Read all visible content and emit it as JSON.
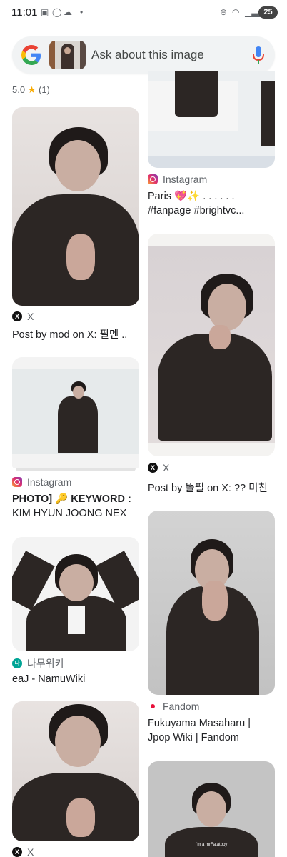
{
  "status_bar": {
    "time": "11:01",
    "left_icons": [
      "screenshot-icon",
      "whatsapp-icon",
      "cloud-icon",
      "dot-icon"
    ],
    "right_icons": [
      "dnd-icon",
      "wifi-icon",
      "signal-icon"
    ],
    "battery": "25"
  },
  "search": {
    "placeholder": "Ask about this image",
    "logo": "google-g-logo",
    "mic": "mic-icon"
  },
  "rating": {
    "value": "5.0",
    "star": "★",
    "count": "(1)"
  },
  "results": {
    "left": [
      {
        "source": "X",
        "source_icon": "x-icon",
        "title": "Post by mod on X: 필멘 .."
      },
      {
        "source": "Instagram",
        "source_icon": "instagram-icon",
        "title_line1": "PHOTO] 🔑 KEYWORD :",
        "title_line2": "KIM HYUN JOONG NEX"
      },
      {
        "source": "나무위키",
        "source_icon": "namuwiki-icon",
        "title": "eaJ - NamuWiki"
      },
      {
        "source": "X",
        "source_icon": "x-icon"
      }
    ],
    "right": [
      {
        "source": "Instagram",
        "source_icon": "instagram-icon",
        "title_line1": "Paris 💖✨ . . . . . .",
        "title_line2": "#fanpage #brightvc..."
      },
      {
        "source": "X",
        "source_icon": "x-icon",
        "title": "Post by 똘필 on X: ?? 미친"
      },
      {
        "source": "Fandom",
        "source_icon": "fandom-icon",
        "title_line1": "Fukuyama Masaharu |",
        "title_line2": "Jpop Wiki | Fandom"
      },
      {
        "caption": "I'm a mrFatatboy"
      }
    ]
  }
}
